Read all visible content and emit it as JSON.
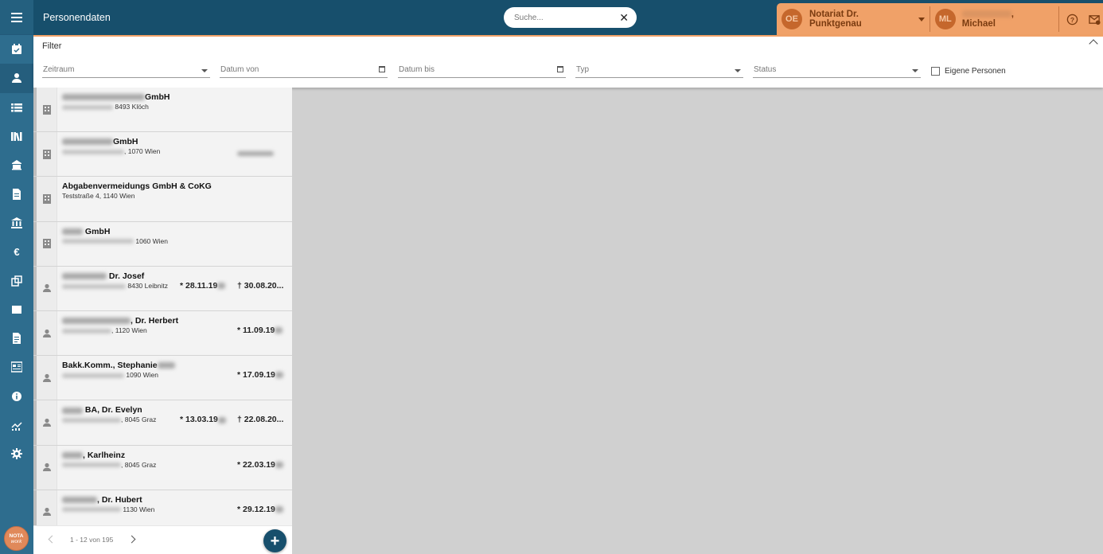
{
  "header": {
    "title": "Personendaten",
    "search_placeholder": "Suche...",
    "notariat_initials": "OE",
    "notariat_label": "Notariat Dr. Punktgenau",
    "user_initials": "ML",
    "user_name_suffix": ", Michael"
  },
  "filter": {
    "title": "Filter",
    "fields": {
      "zeitraum": "Zeitraum",
      "datum_von": "Datum von",
      "datum_bis": "Datum bis",
      "typ": "Typ",
      "status": "Status"
    },
    "checkbox_label": "Eigene Personen"
  },
  "rail_icons": [
    "menu-icon",
    "calendar-check-icon",
    "person-icon",
    "list-icon",
    "library-icon",
    "building-icon",
    "document-icon",
    "bank-icon",
    "euro-icon",
    "copy-icon",
    "square-icon",
    "file-icon",
    "newspaper-icon",
    "info-icon",
    "chart-icon",
    "settings-icon"
  ],
  "list": [
    {
      "type": "company",
      "name": "GmbH",
      "addr": "8493 Klöch",
      "born": "",
      "died": ""
    },
    {
      "type": "company",
      "name": "GmbH",
      "addr": ", 1070 Wien",
      "born": "",
      "died": ""
    },
    {
      "type": "company",
      "name": "Abgabenvermeidungs GmbH & CoKG",
      "addr": "Teststraße 4, 1140 Wien",
      "born": "",
      "died": ""
    },
    {
      "type": "company",
      "name": "GmbH",
      "addr": "1060 Wien",
      "born": "",
      "died": ""
    },
    {
      "type": "person",
      "name": "Dr. Josef",
      "addr": "8430 Leibnitz",
      "born": "* 28.11.19",
      "died": "† 30.08.20..."
    },
    {
      "type": "person",
      "name": ", Dr. Herbert",
      "addr": ", 1120 Wien",
      "born": "",
      "died": "* 11.09.19"
    },
    {
      "type": "person",
      "name": "Bakk.Komm., Stephanie",
      "addr": "1090 Wien",
      "born": "",
      "died": "* 17.09.19"
    },
    {
      "type": "person",
      "name": "BA, Dr. Evelyn",
      "addr": ", 8045 Graz",
      "born": "* 13.03.19",
      "died": "† 22.08.20..."
    },
    {
      "type": "person",
      "name": ", Karlheinz",
      "addr": ", 8045 Graz",
      "born": "",
      "died": "* 22.03.19"
    },
    {
      "type": "person",
      "name": ", Dr. Hubert",
      "addr": "1130 Wien",
      "born": "",
      "died": "* 29.12.19"
    }
  ],
  "pager": {
    "count": "1 - 12 von 195",
    "add": "+"
  },
  "logo": {
    "line1": "NOTA",
    "line2": "work"
  }
}
